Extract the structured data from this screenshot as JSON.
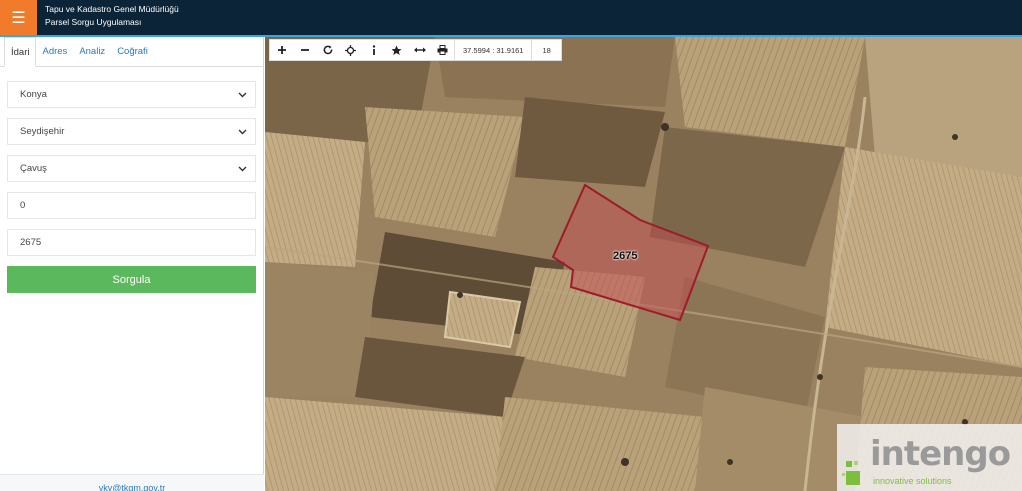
{
  "header": {
    "menu_icon": "hamburger-icon",
    "title": "Tapu ve Kadastro Genel Müdürlüğü",
    "subtitle": "Parsel Sorgu Uygulaması",
    "colors": {
      "bar": "#0b2438",
      "menu": "#f07b2a",
      "accent": "#3aa6df"
    }
  },
  "sidebar": {
    "tabs": [
      {
        "label": "İdari",
        "active": true
      },
      {
        "label": "Adres",
        "active": false
      },
      {
        "label": "Analiz",
        "active": false
      },
      {
        "label": "Coğrafi",
        "active": false
      }
    ],
    "province": "Konya",
    "district": "Seydişehir",
    "neighborhood": "Çavuş",
    "block_value": "0",
    "parcel_value": "2675",
    "submit_label": "Sorgula",
    "submit_color": "#5cb85c",
    "footer_email": "yky@tkgm.gov.tr"
  },
  "map": {
    "toolbar": [
      {
        "icon": "zoom-in-icon"
      },
      {
        "icon": "zoom-out-icon"
      },
      {
        "icon": "refresh-icon"
      },
      {
        "icon": "locate-icon"
      },
      {
        "icon": "info-icon"
      },
      {
        "icon": "star-icon"
      },
      {
        "icon": "measure-icon"
      },
      {
        "icon": "print-icon"
      }
    ],
    "coordinates": "37.5994 : 31.9161",
    "zoom_level": "18",
    "parcel_label": "2675",
    "parcel_color": "#9c1c2c"
  },
  "watermark": {
    "brand": "intengo",
    "tagline": "innovative solutions"
  }
}
